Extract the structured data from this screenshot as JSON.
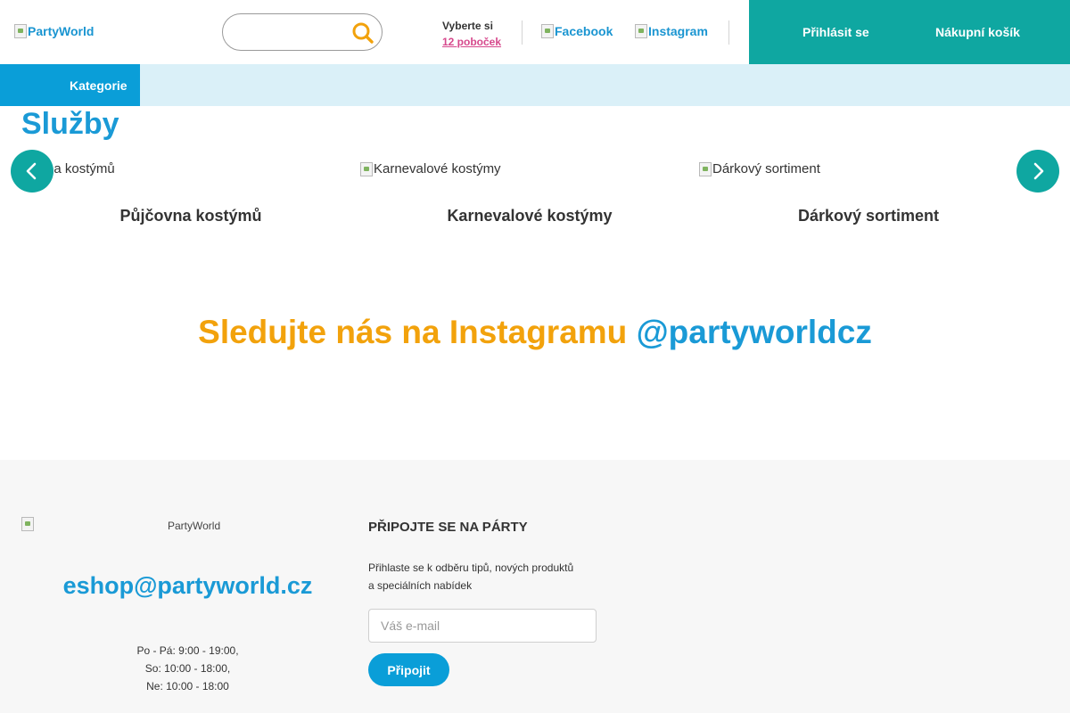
{
  "header": {
    "logo_alt": "PartyWorld",
    "search": {
      "placeholder": ""
    },
    "branches": {
      "label": "Vyberte si",
      "link": "12 poboček"
    },
    "social": {
      "facebook": "Facebook",
      "instagram": "Instagram"
    },
    "login": "Přihlásit se",
    "cart": "Nákupní košík"
  },
  "nav": {
    "categories": "Kategorie"
  },
  "services": {
    "title": "Služby",
    "slides": [
      {
        "img_alt": "Půjčovna kostýmů",
        "title": "Půjčovna kostýmů"
      },
      {
        "img_alt": "Karnevalové kostýmy",
        "title": "Karnevalové kostýmy"
      },
      {
        "img_alt": "Dárkový sortiment",
        "title": "Dárkový sortiment"
      }
    ]
  },
  "instagram": {
    "text": "Sledujte nás na Instagramu",
    "handle": "@partyworldcz"
  },
  "footer": {
    "logo_alt": "PartyWorld",
    "email": "eshop@partyworld.cz",
    "hours": [
      "Po - Pá: 9:00 - 19:00,",
      "So: 10:00 - 18:00,",
      "Ne: 10:00 - 18:00"
    ],
    "join_title": "PŘIPOJTE SE NA PÁRTY",
    "join_desc": [
      "Přihlaste se k odběru tipů, nových produktů",
      "a speciálních nabídek"
    ],
    "email_placeholder": "Váš e-mail",
    "join_button": "Připojit"
  },
  "colors": {
    "accent": "#0fa7a1",
    "blue": "#1a9ad6",
    "category_blue": "#0a9ed8",
    "nav_bg": "#daf0f8",
    "orange": "#f2a20c",
    "pink_link": "#d6488c",
    "footer_bg": "#f7f7f7"
  },
  "icons": {
    "search": "search-icon",
    "prev": "chevron-left-icon",
    "next": "chevron-right-icon",
    "broken_image": "broken-image-icon"
  }
}
